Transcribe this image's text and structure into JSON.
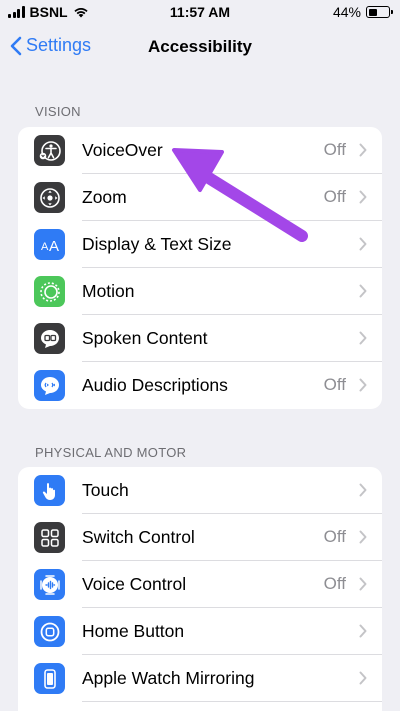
{
  "status": {
    "carrier": "BSNL",
    "time": "11:57 AM",
    "battery": "44%",
    "battery_level": 0.44
  },
  "nav": {
    "back_label": "Settings",
    "title": "Accessibility"
  },
  "sections": [
    {
      "header": "VISION",
      "rows": [
        {
          "label": "VoiceOver",
          "value": "Off",
          "icon": "voiceover-icon",
          "color": "#3a3a3c"
        },
        {
          "label": "Zoom",
          "value": "Off",
          "icon": "zoom-icon",
          "color": "#3a3a3c"
        },
        {
          "label": "Display & Text Size",
          "value": "",
          "icon": "text-size-icon",
          "color": "#2f7bf5"
        },
        {
          "label": "Motion",
          "value": "",
          "icon": "motion-icon",
          "color": "#4cc75a"
        },
        {
          "label": "Spoken Content",
          "value": "",
          "icon": "speech-bubble-icon",
          "color": "#3a3a3c"
        },
        {
          "label": "Audio Descriptions",
          "value": "Off",
          "icon": "audio-description-icon",
          "color": "#2f7bf5"
        }
      ]
    },
    {
      "header": "PHYSICAL AND MOTOR",
      "rows": [
        {
          "label": "Touch",
          "value": "",
          "icon": "hand-pointer-icon",
          "color": "#2f7bf5"
        },
        {
          "label": "Switch Control",
          "value": "Off",
          "icon": "switch-grid-icon",
          "color": "#3a3a3c"
        },
        {
          "label": "Voice Control",
          "value": "Off",
          "icon": "voice-control-icon",
          "color": "#2f7bf5"
        },
        {
          "label": "Home Button",
          "value": "",
          "icon": "home-button-icon",
          "color": "#2f7bf5"
        },
        {
          "label": "Apple Watch Mirroring",
          "value": "",
          "icon": "watch-icon",
          "color": "#2f7bf5"
        }
      ]
    }
  ],
  "annotation_color": "#a347e8"
}
